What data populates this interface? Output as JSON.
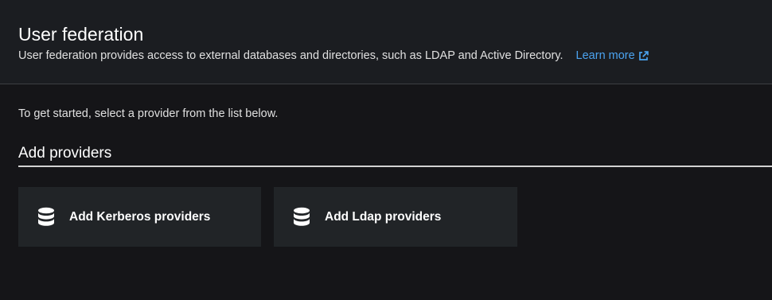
{
  "header": {
    "title": "User federation",
    "description": "User federation provides access to external databases and directories, such as LDAP and Active Directory.",
    "learn_more_label": "Learn more",
    "learn_more_icon": "external-link-icon"
  },
  "main": {
    "intro": "To get started, select a provider from the list below.",
    "section_title": "Add providers",
    "providers": [
      {
        "label": "Add Kerberos providers",
        "icon": "database-icon"
      },
      {
        "label": "Add Ldap providers",
        "icon": "database-icon"
      }
    ]
  },
  "colors": {
    "background": "#151518",
    "header_background": "#1b1d21",
    "card_background": "#212427",
    "link": "#4ba3f0",
    "text": "#ffffff"
  }
}
